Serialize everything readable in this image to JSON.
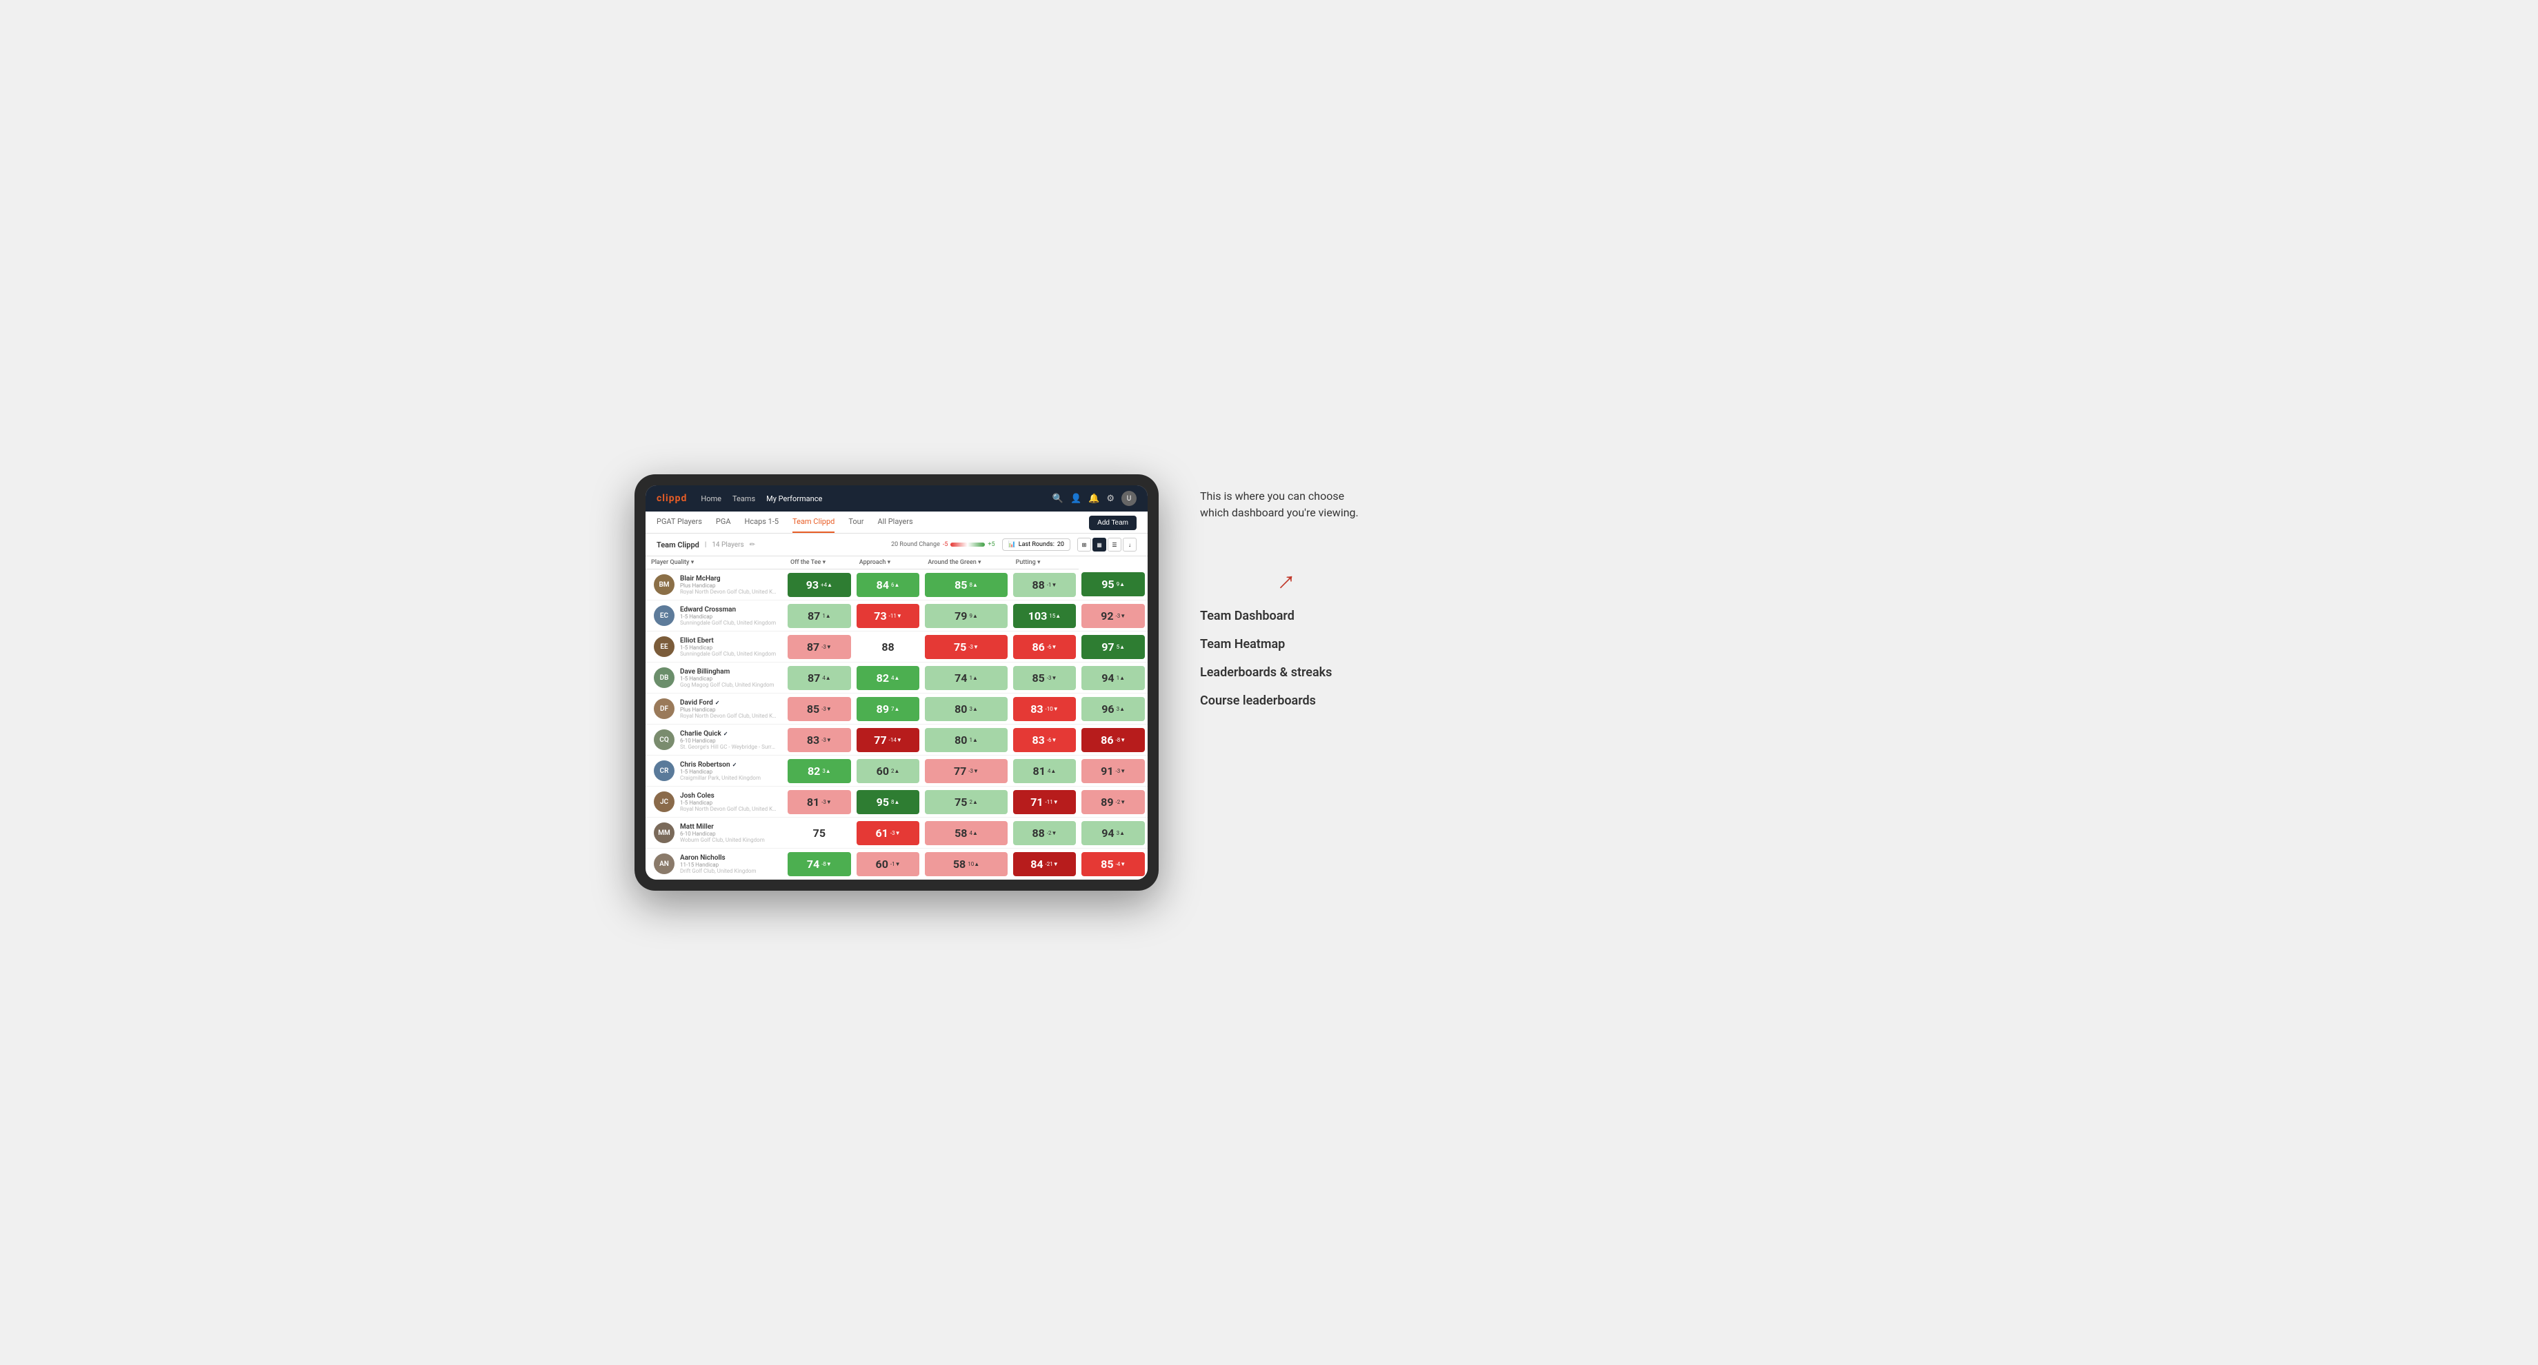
{
  "annotation": {
    "description": "This is where you can choose which dashboard you're viewing.",
    "arrow_symbol": "↗",
    "items": [
      {
        "id": "team-dashboard",
        "label": "Team Dashboard"
      },
      {
        "id": "team-heatmap",
        "label": "Team Heatmap"
      },
      {
        "id": "leaderboards",
        "label": "Leaderboards & streaks"
      },
      {
        "id": "course-leaderboards",
        "label": "Course leaderboards"
      }
    ]
  },
  "nav": {
    "logo": "clippd",
    "links": [
      {
        "label": "Home",
        "active": false
      },
      {
        "label": "Teams",
        "active": false
      },
      {
        "label": "My Performance",
        "active": false
      }
    ],
    "icons": [
      "🔍",
      "👤",
      "🔔",
      "⚙",
      "👤"
    ]
  },
  "sub_nav": {
    "links": [
      {
        "label": "PGAT Players",
        "active": false
      },
      {
        "label": "PGA",
        "active": false
      },
      {
        "label": "Hcaps 1-5",
        "active": false
      },
      {
        "label": "Team Clippd",
        "active": true
      },
      {
        "label": "Tour",
        "active": false
      },
      {
        "label": "All Players",
        "active": false
      }
    ],
    "add_team_label": "Add Team"
  },
  "team_header": {
    "title": "Team Clippd",
    "separator": "|",
    "count": "14 Players",
    "round_change_label": "20 Round Change",
    "change_neg": "-5",
    "change_pos": "+5",
    "last_rounds_label": "Last Rounds:",
    "last_rounds_value": "20"
  },
  "table": {
    "headers": {
      "player": "Player Quality ▾",
      "off_tee": "Off the Tee ▾",
      "approach": "Approach ▾",
      "around_green": "Around the Green ▾",
      "putting": "Putting ▾"
    },
    "players": [
      {
        "name": "Blair McHarg",
        "handicap": "Plus Handicap",
        "club": "Royal North Devon Golf Club, United Kingdom",
        "avatar_color": "#8B6F47",
        "initials": "BM",
        "scores": [
          {
            "value": 93,
            "change": "+4",
            "direction": "up",
            "color": "green-dark"
          },
          {
            "value": 84,
            "change": "6",
            "direction": "up",
            "color": "green-medium"
          },
          {
            "value": 85,
            "change": "8",
            "direction": "up",
            "color": "green-medium"
          },
          {
            "value": 88,
            "change": "-1",
            "direction": "down",
            "color": "green-light"
          },
          {
            "value": 95,
            "change": "9",
            "direction": "up",
            "color": "green-dark"
          }
        ]
      },
      {
        "name": "Edward Crossman",
        "handicap": "1-5 Handicap",
        "club": "Sunningdale Golf Club, United Kingdom",
        "avatar_color": "#5D7B9A",
        "initials": "EC",
        "scores": [
          {
            "value": 87,
            "change": "1",
            "direction": "up",
            "color": "green-light"
          },
          {
            "value": 73,
            "change": "-11",
            "direction": "down",
            "color": "red-medium"
          },
          {
            "value": 79,
            "change": "9",
            "direction": "up",
            "color": "green-light"
          },
          {
            "value": 103,
            "change": "15",
            "direction": "up",
            "color": "green-dark"
          },
          {
            "value": 92,
            "change": "-3",
            "direction": "down",
            "color": "red-light"
          }
        ]
      },
      {
        "name": "Elliot Ebert",
        "handicap": "1-5 Handicap",
        "club": "Sunningdale Golf Club, United Kingdom",
        "avatar_color": "#7B5C3A",
        "initials": "EE",
        "scores": [
          {
            "value": 87,
            "change": "-3",
            "direction": "down",
            "color": "red-light"
          },
          {
            "value": 88,
            "change": "",
            "direction": "",
            "color": "white-bg"
          },
          {
            "value": 75,
            "change": "-3",
            "direction": "down",
            "color": "red-medium"
          },
          {
            "value": 86,
            "change": "-6",
            "direction": "down",
            "color": "red-medium"
          },
          {
            "value": 97,
            "change": "5",
            "direction": "up",
            "color": "green-dark"
          }
        ]
      },
      {
        "name": "Dave Billingham",
        "handicap": "1-5 Handicap",
        "club": "Gog Magog Golf Club, United Kingdom",
        "avatar_color": "#6B8E6B",
        "initials": "DB",
        "scores": [
          {
            "value": 87,
            "change": "4",
            "direction": "up",
            "color": "green-light"
          },
          {
            "value": 82,
            "change": "4",
            "direction": "up",
            "color": "green-medium"
          },
          {
            "value": 74,
            "change": "1",
            "direction": "up",
            "color": "green-light"
          },
          {
            "value": 85,
            "change": "-3",
            "direction": "down",
            "color": "green-light"
          },
          {
            "value": 94,
            "change": "1",
            "direction": "up",
            "color": "green-light"
          }
        ]
      },
      {
        "name": "David Ford",
        "verified": true,
        "handicap": "Plus Handicap",
        "club": "Royal North Devon Golf Club, United Kingdom",
        "avatar_color": "#9A7A5A",
        "initials": "DF",
        "scores": [
          {
            "value": 85,
            "change": "-3",
            "direction": "down",
            "color": "red-light"
          },
          {
            "value": 89,
            "change": "7",
            "direction": "up",
            "color": "green-medium"
          },
          {
            "value": 80,
            "change": "3",
            "direction": "up",
            "color": "green-light"
          },
          {
            "value": 83,
            "change": "-10",
            "direction": "down",
            "color": "red-medium"
          },
          {
            "value": 96,
            "change": "3",
            "direction": "up",
            "color": "green-light"
          }
        ]
      },
      {
        "name": "Charlie Quick",
        "verified": true,
        "handicap": "6-10 Handicap",
        "club": "St. George's Hill GC - Weybridge - Surrey, Uni...",
        "avatar_color": "#7A8C6E",
        "initials": "CQ",
        "scores": [
          {
            "value": 83,
            "change": "-3",
            "direction": "down",
            "color": "red-light"
          },
          {
            "value": 77,
            "change": "-14",
            "direction": "down",
            "color": "red-dark"
          },
          {
            "value": 80,
            "change": "1",
            "direction": "up",
            "color": "green-light"
          },
          {
            "value": 83,
            "change": "-6",
            "direction": "down",
            "color": "red-medium"
          },
          {
            "value": 86,
            "change": "-8",
            "direction": "down",
            "color": "red-dark"
          }
        ]
      },
      {
        "name": "Chris Robertson",
        "verified": true,
        "handicap": "1-5 Handicap",
        "club": "Craigmillar Park, United Kingdom",
        "avatar_color": "#5A7A9A",
        "initials": "CR",
        "scores": [
          {
            "value": 82,
            "change": "3",
            "direction": "up",
            "color": "green-medium"
          },
          {
            "value": 60,
            "change": "2",
            "direction": "up",
            "color": "green-light"
          },
          {
            "value": 77,
            "change": "-3",
            "direction": "down",
            "color": "red-light"
          },
          {
            "value": 81,
            "change": "4",
            "direction": "up",
            "color": "green-light"
          },
          {
            "value": 91,
            "change": "-3",
            "direction": "down",
            "color": "red-light"
          }
        ]
      },
      {
        "name": "Josh Coles",
        "handicap": "1-5 Handicap",
        "club": "Royal North Devon Golf Club, United Kingdom",
        "avatar_color": "#8A6A4A",
        "initials": "JC",
        "scores": [
          {
            "value": 81,
            "change": "-3",
            "direction": "down",
            "color": "red-light"
          },
          {
            "value": 95,
            "change": "8",
            "direction": "up",
            "color": "green-dark"
          },
          {
            "value": 75,
            "change": "2",
            "direction": "up",
            "color": "green-light"
          },
          {
            "value": 71,
            "change": "-11",
            "direction": "down",
            "color": "red-dark"
          },
          {
            "value": 89,
            "change": "-2",
            "direction": "down",
            "color": "red-light"
          }
        ]
      },
      {
        "name": "Matt Miller",
        "handicap": "6-10 Handicap",
        "club": "Woburn Golf Club, United Kingdom",
        "avatar_color": "#7A6A5A",
        "initials": "MM",
        "scores": [
          {
            "value": 75,
            "change": "",
            "direction": "",
            "color": "white-bg"
          },
          {
            "value": 61,
            "change": "-3",
            "direction": "down",
            "color": "red-medium"
          },
          {
            "value": 58,
            "change": "4",
            "direction": "up",
            "color": "red-light"
          },
          {
            "value": 88,
            "change": "-2",
            "direction": "down",
            "color": "green-light"
          },
          {
            "value": 94,
            "change": "3",
            "direction": "up",
            "color": "green-light"
          }
        ]
      },
      {
        "name": "Aaron Nicholls",
        "handicap": "11-15 Handicap",
        "club": "Drift Golf Club, United Kingdom",
        "avatar_color": "#8A7A6A",
        "initials": "AN",
        "scores": [
          {
            "value": 74,
            "change": "-8",
            "direction": "down",
            "color": "green-medium"
          },
          {
            "value": 60,
            "change": "-1",
            "direction": "down",
            "color": "red-light"
          },
          {
            "value": 58,
            "change": "10",
            "direction": "up",
            "color": "red-light"
          },
          {
            "value": 84,
            "change": "-21",
            "direction": "down",
            "color": "red-dark"
          },
          {
            "value": 85,
            "change": "-4",
            "direction": "down",
            "color": "red-medium"
          }
        ]
      }
    ]
  }
}
